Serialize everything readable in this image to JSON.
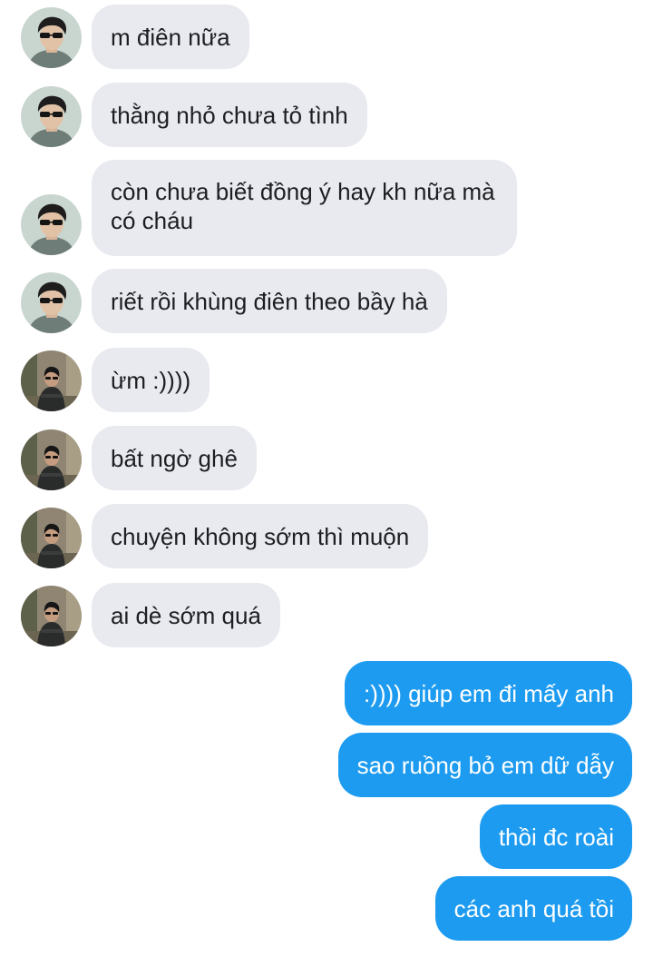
{
  "conversation": {
    "messages": [
      {
        "sender": "contact-a",
        "text": "m điên nữa"
      },
      {
        "sender": "contact-a",
        "text": "thằng nhỏ chưa tỏ tình"
      },
      {
        "sender": "contact-a",
        "text": "còn chưa biết đồng ý hay kh nữa mà có cháu"
      },
      {
        "sender": "contact-a",
        "text": "riết rồi khùng điên theo bầy hà"
      },
      {
        "sender": "contact-b",
        "text": "ừm :))))"
      },
      {
        "sender": "contact-b",
        "text": "bất ngờ ghê"
      },
      {
        "sender": "contact-b",
        "text": "chuyện không sớm thì muộn"
      },
      {
        "sender": "contact-b",
        "text": "ai dè sớm quá"
      },
      {
        "sender": "me",
        "text": ":)))) giúp em đi mấy anh"
      },
      {
        "sender": "me",
        "text": "sao ruồng bỏ em dữ dẫy"
      },
      {
        "sender": "me",
        "text": "thồi đc roài"
      },
      {
        "sender": "me",
        "text": "các anh quá tồi"
      }
    ]
  },
  "colors": {
    "incoming_bubble": "#e8eaef",
    "outgoing_bubble": "#1d9bf0",
    "incoming_text": "#1c1e21",
    "outgoing_text": "#ffffff"
  },
  "icons": {
    "contact_a_avatar": "avatar-sunglasses-portrait",
    "contact_b_avatar": "avatar-standing-figure"
  }
}
